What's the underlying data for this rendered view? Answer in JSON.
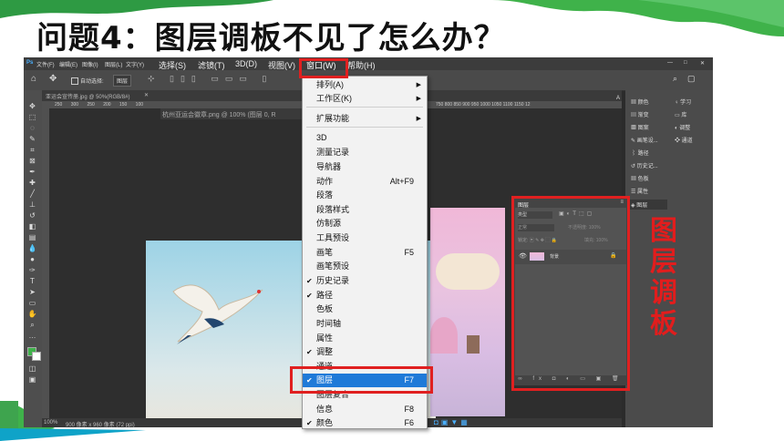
{
  "slide": {
    "title": "问题4：图层调板不见了怎么办？",
    "side_label": "图层调板",
    "colors": {
      "green_deco": "#3fb24a",
      "highlight": "#e02020",
      "label": "#e21d1d"
    }
  },
  "menubar": {
    "ps_logo": "Ps",
    "items": [
      "文件(F)",
      "编辑(E)",
      "图像(I)",
      "图层(L)",
      "文字(Y)",
      "选择(S)",
      "滤镜(T)",
      "3D(D)",
      "视图(V)",
      "窗口(W)",
      "帮助(H)"
    ],
    "window_controls": [
      "—",
      "□",
      "✕"
    ]
  },
  "options_bar": {
    "auto_select": "自动选择:",
    "auto_select_value": "图层"
  },
  "tabs": {
    "tab1": "亚运会宣传册.jpg @ 50%(RGB/8#)",
    "tab2": "杭州亚运会徽章.png @ 100% (图层 0, R"
  },
  "ruler_numbers": "250 300 250 200 150 100",
  "ruler_numbers_right": "750  800  850  900  950  1000  1050  1100  1150  12",
  "status_bar": {
    "zoom": "100%",
    "doc_info": "900 像素 x 960 像素 (72 ppi)"
  },
  "window_menu": {
    "items": [
      {
        "label": "排列(A)",
        "submenu": true
      },
      {
        "label": "工作区(K)",
        "submenu": true
      },
      {
        "label": "扩展功能",
        "submenu": true
      },
      {
        "label": "3D"
      },
      {
        "label": "测量记录"
      },
      {
        "label": "导航器"
      },
      {
        "label": "动作",
        "shortcut": "Alt+F9"
      },
      {
        "label": "段落"
      },
      {
        "label": "段落样式"
      },
      {
        "label": "仿制源"
      },
      {
        "label": "工具预设"
      },
      {
        "label": "画笔",
        "shortcut": "F5"
      },
      {
        "label": "画笔预设"
      },
      {
        "label": "历史记录",
        "checked": true
      },
      {
        "label": "路径",
        "checked": true
      },
      {
        "label": "色板"
      },
      {
        "label": "时间轴"
      },
      {
        "label": "属性"
      },
      {
        "label": "调整",
        "checked": true
      },
      {
        "label": "通道"
      },
      {
        "label": "图层",
        "shortcut": "F7",
        "checked": true,
        "selected": true
      },
      {
        "label": "图层复合"
      },
      {
        "label": "信息",
        "shortcut": "F8"
      },
      {
        "label": "颜色",
        "shortcut": "F6",
        "checked": true
      }
    ]
  },
  "right_panels": {
    "column_a": [
      "颜色",
      "渐变",
      "图案",
      "画笔设...",
      "路径",
      "历史记...",
      "色板",
      "属性",
      "图层"
    ],
    "column_b": [
      "学习",
      "库",
      "调整",
      "通道"
    ]
  },
  "layers_panel": {
    "title": "图层",
    "filter": "类型",
    "blend_mode": "正常",
    "opacity_label": "不透明度:",
    "opacity": "100%",
    "lock_label": "锁定:",
    "fill_label": "填充:",
    "fill": "100%",
    "layer_name": "背景"
  }
}
